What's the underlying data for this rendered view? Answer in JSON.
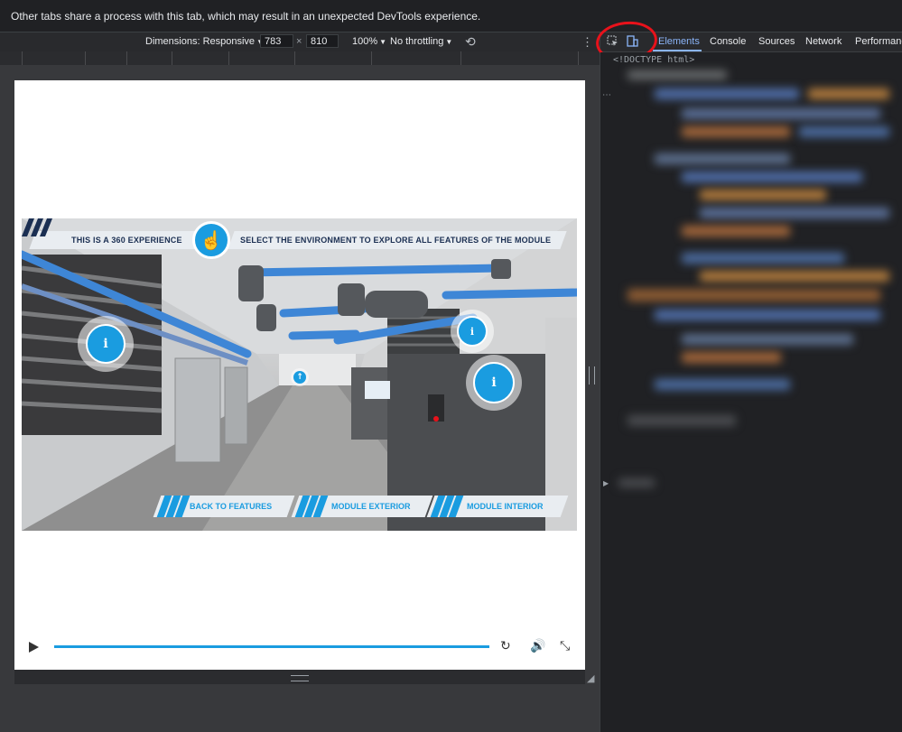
{
  "infobar": {
    "message": "Other tabs share a process with this tab, which may result in an unexpected DevTools experience."
  },
  "device_toolbar": {
    "dimensions_label": "Dimensions: Responsive",
    "width_value": "783",
    "times": "×",
    "height_value": "810",
    "zoom": "100%",
    "throttling": "No throttling",
    "more_icon": "kebab-icon",
    "rotate_icon": "rotate-icon"
  },
  "devtools": {
    "tabs": [
      {
        "label": "Elements",
        "active": true
      },
      {
        "label": "Console",
        "active": false
      },
      {
        "label": "Sources",
        "active": false
      },
      {
        "label": "Network",
        "active": false
      },
      {
        "label": "Performance",
        "active": false
      }
    ],
    "doctype": "<!DOCTYPE html>",
    "inspect_icon": "inspect-element-icon",
    "device_icon": "device-toggle-icon"
  },
  "scene": {
    "banner_left": "THIS IS A 360 EXPERIENCE",
    "banner_right": "SELECT THE ENVIRONMENT TO EXPLORE ALL FEATURES OF THE MODULE",
    "hotspot_glyph": "i",
    "nav": [
      {
        "label": "BACK TO FEATURES"
      },
      {
        "label": "MODULE EXTERIOR"
      },
      {
        "label": "MODULE INTERIOR"
      }
    ]
  },
  "video_controls": {
    "play_icon": "play-icon",
    "progress": 1.0,
    "replay_icon": "replay-icon",
    "volume_icon": "volume-icon",
    "exit_fullscreen_icon": "exit-fullscreen-icon"
  },
  "colors": {
    "accent": "#1a9ce0",
    "annotation": "#e8121b",
    "devtools_bg": "#202124",
    "active_tab": "#8ab4f8"
  }
}
